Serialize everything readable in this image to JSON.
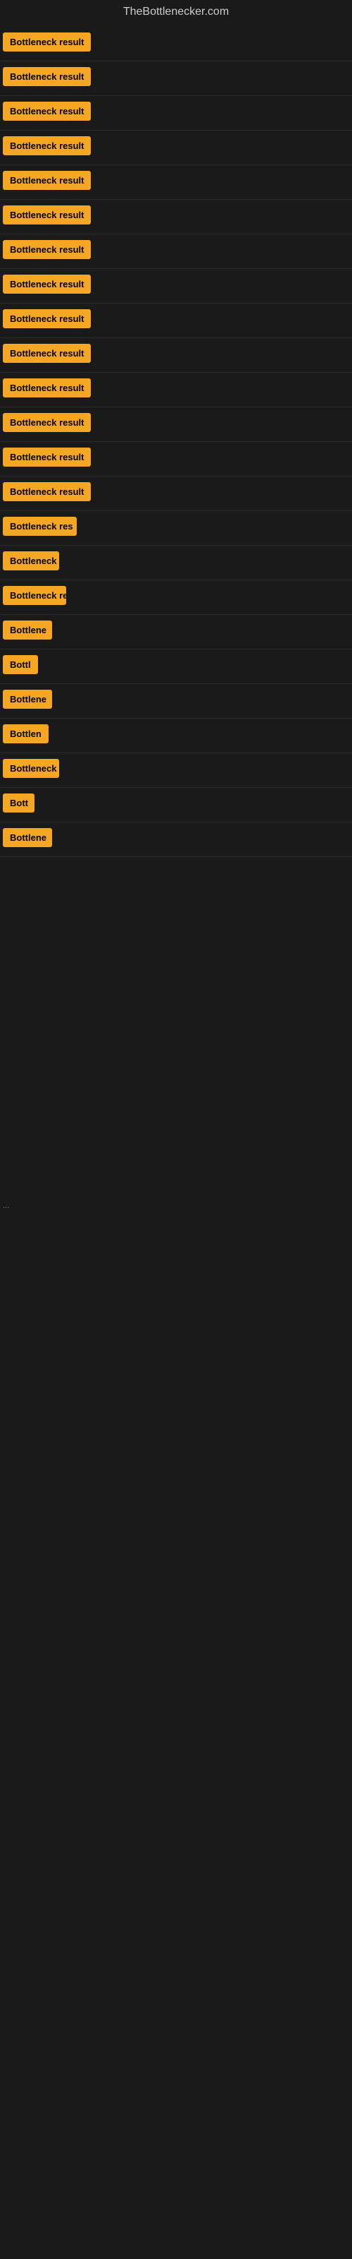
{
  "site": {
    "title": "TheBottlenecker.com"
  },
  "results": [
    {
      "id": 1,
      "label": "Bottleneck result",
      "width": 130
    },
    {
      "id": 2,
      "label": "Bottleneck result",
      "width": 130
    },
    {
      "id": 3,
      "label": "Bottleneck result",
      "width": 130
    },
    {
      "id": 4,
      "label": "Bottleneck result",
      "width": 130
    },
    {
      "id": 5,
      "label": "Bottleneck result",
      "width": 130
    },
    {
      "id": 6,
      "label": "Bottleneck result",
      "width": 130
    },
    {
      "id": 7,
      "label": "Bottleneck result",
      "width": 130
    },
    {
      "id": 8,
      "label": "Bottleneck result",
      "width": 130
    },
    {
      "id": 9,
      "label": "Bottleneck result",
      "width": 130
    },
    {
      "id": 10,
      "label": "Bottleneck result",
      "width": 130
    },
    {
      "id": 11,
      "label": "Bottleneck result",
      "width": 130
    },
    {
      "id": 12,
      "label": "Bottleneck result",
      "width": 130
    },
    {
      "id": 13,
      "label": "Bottleneck result",
      "width": 130
    },
    {
      "id": 14,
      "label": "Bottleneck result",
      "width": 130
    },
    {
      "id": 15,
      "label": "Bottleneck res",
      "width": 105
    },
    {
      "id": 16,
      "label": "Bottleneck",
      "width": 80
    },
    {
      "id": 17,
      "label": "Bottleneck re",
      "width": 90
    },
    {
      "id": 18,
      "label": "Bottlene",
      "width": 70
    },
    {
      "id": 19,
      "label": "Bottl",
      "width": 50
    },
    {
      "id": 20,
      "label": "Bottlene",
      "width": 70
    },
    {
      "id": 21,
      "label": "Bottlen",
      "width": 65
    },
    {
      "id": 22,
      "label": "Bottleneck",
      "width": 80
    },
    {
      "id": 23,
      "label": "Bott",
      "width": 45
    },
    {
      "id": 24,
      "label": "Bottlene",
      "width": 70
    }
  ],
  "ellipsis": "..."
}
